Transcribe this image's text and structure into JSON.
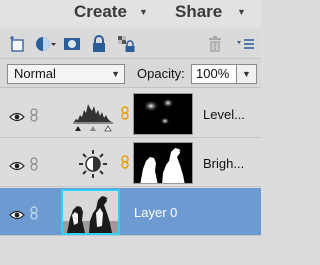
{
  "header": {
    "menus": [
      {
        "label": "Create"
      },
      {
        "label": "Share"
      }
    ]
  },
  "toolbar": {
    "icons": [
      "new-layer-icon",
      "adjustment-layer-icon",
      "add-mask-icon",
      "lock-all-icon",
      "lock-transparency-icon",
      "trash-icon",
      "panel-menu-icon"
    ]
  },
  "blend": {
    "mode": "Normal",
    "opacity_label": "Opacity:",
    "opacity_value": "100%"
  },
  "layers": [
    {
      "name": "Level...",
      "type": "levels-adjustment",
      "visible": true,
      "selected": false
    },
    {
      "name": "Brigh...",
      "type": "brightness-contrast-adjustment",
      "visible": true,
      "selected": false
    },
    {
      "name": "Layer 0",
      "type": "image",
      "visible": true,
      "selected": true
    }
  ],
  "colors": {
    "selection": "#6d9bd1",
    "panel": "#dcdcdc",
    "thumb_highlight": "#2fd0ff",
    "link_orange": "#e8a000"
  }
}
